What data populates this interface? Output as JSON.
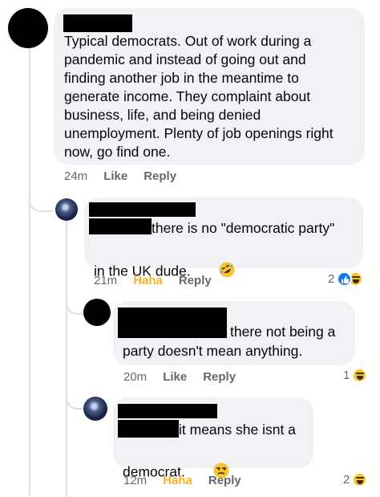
{
  "comments": [
    {
      "text": "Typical democrats. Out of work during a\npandemic and instead of going out and\nfinding another job in the meantime to\ngenerate income. They complaint about\nbusiness, life, and being denied\nunemployment. Plenty of job openings right\nnow, go find one.",
      "time": "24m",
      "like_label": "Like",
      "reply_label": "Reply"
    }
  ],
  "replies": [
    {
      "line1": "there is no \"democratic party\"",
      "line2": "in the UK dude.",
      "emoji": "rolling-on-floor-laughing",
      "time": "21m",
      "reaction_label": "Haha",
      "reply_label": "Reply",
      "reaction_count": "2",
      "reactions": [
        "like",
        "haha"
      ]
    },
    {
      "line1": "there not being a",
      "line2": "party doesn't mean anything.",
      "time": "20m",
      "like_label": "Like",
      "reply_label": "Reply",
      "reaction_count": "1",
      "reactions": [
        "haha"
      ]
    },
    {
      "line1": "it means she isnt a",
      "line2": "democrat.",
      "emoji": "unamused-face",
      "time": "12m",
      "reaction_label": "Haha",
      "reply_label": "Reply",
      "reaction_count": "2",
      "reactions": [
        "haha"
      ]
    }
  ],
  "colors": {
    "bubble": "#f0f2f5",
    "meta_text": "#65676b",
    "haha_accent": "#f7b125",
    "like_blue": "#1877f2"
  }
}
